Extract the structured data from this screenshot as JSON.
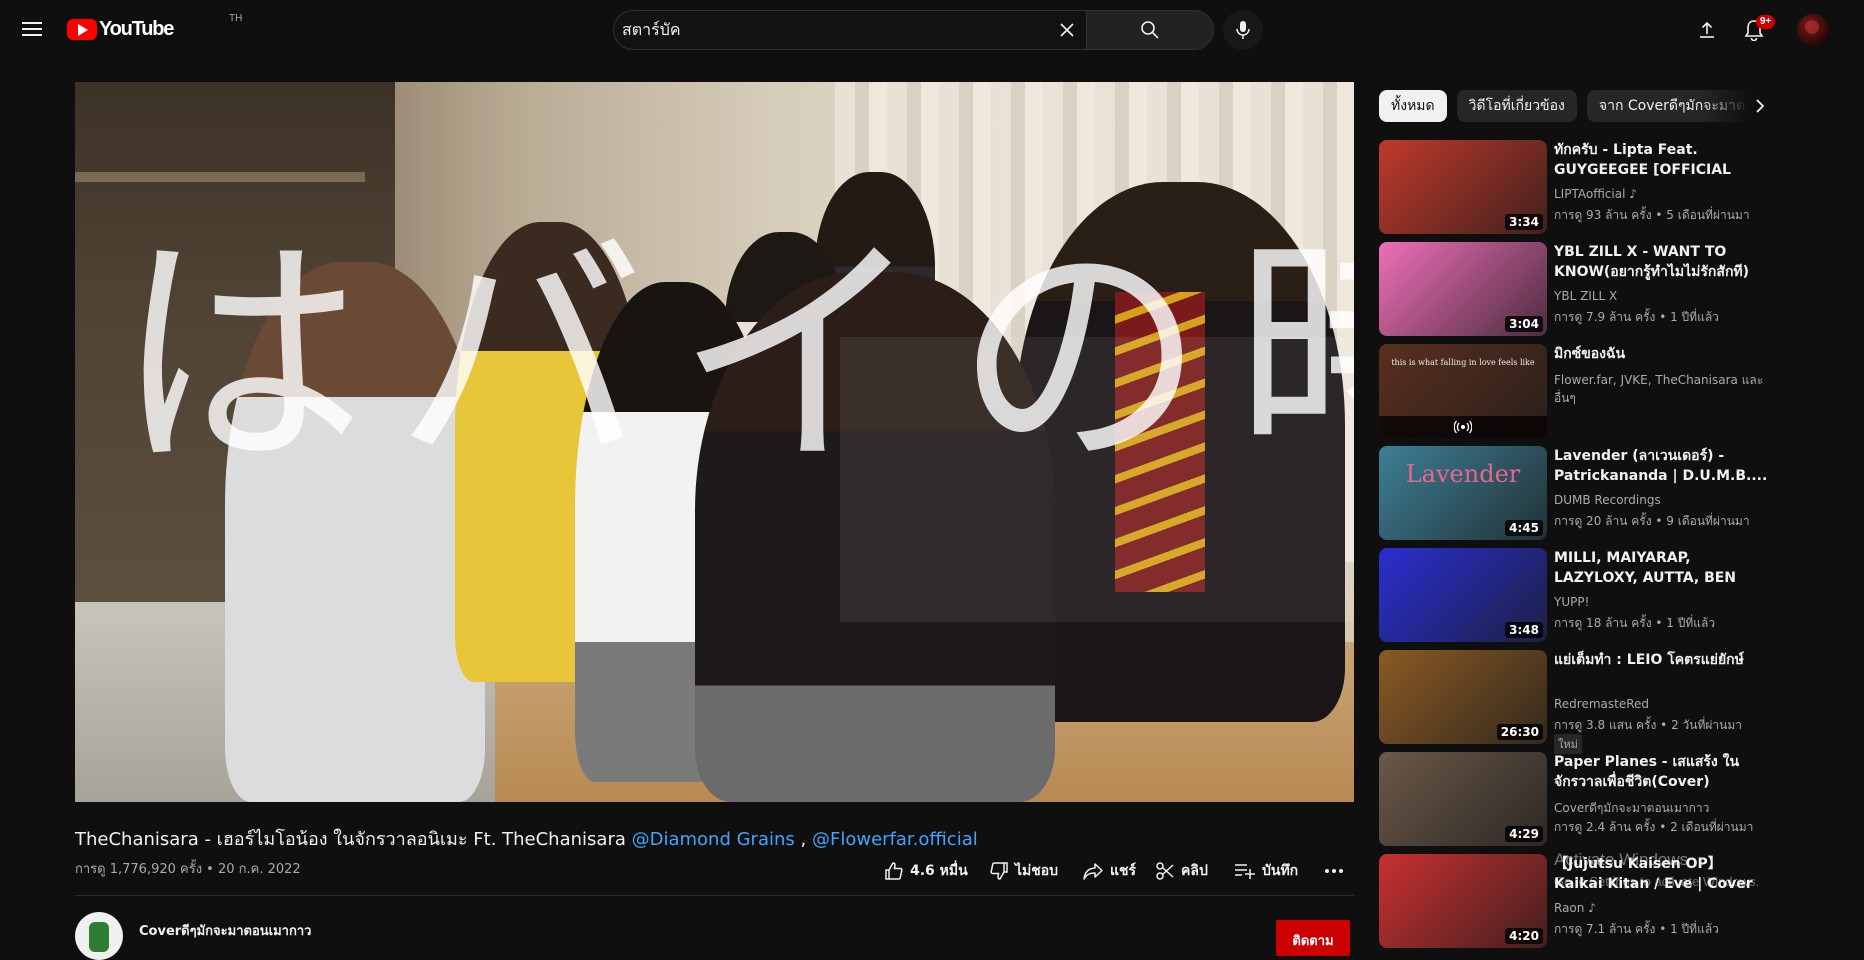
{
  "header": {
    "logo_text": "YouTube",
    "country_code": "TH",
    "search_value": "สตาร์บัค",
    "notification_count": "9+"
  },
  "player": {
    "overlay_text": "はバイの時"
  },
  "video": {
    "title_main": "TheChanisara - เฮอร์ไมโอน้อง ในจักรวาลอนิเมะ Ft. TheChanisara",
    "mention_1": "@Diamond Grains",
    "mention_sep": ",",
    "mention_2": "@Flowerfar.official",
    "meta": "การดู 1,776,920 ครั้ง • 20 ก.ค. 2022",
    "likes": "4.6 หมื่น",
    "dislike_label": "ไม่ชอบ",
    "share_label": "แชร์",
    "clip_label": "คลิป",
    "save_label": "บันทึก",
    "channel_name": "Coverดีๆมักจะมาตอนเมากาว",
    "subscribe_label": "ติดตาม"
  },
  "chips": [
    {
      "label": "ทั้งหมด",
      "active": true
    },
    {
      "label": "วิดีโอที่เกี่ยวข้อง",
      "active": false
    },
    {
      "label": "จาก Coverดีๆมักจะมาตอนเมากาว",
      "active": false
    }
  ],
  "recommendations": [
    {
      "title": "ทักครับ - Lipta Feat. GUYGEEGEE [OFFICIAL MUSIC VIDEO]",
      "channel": "LIPTAofficial ♪",
      "stats": "การดู 93 ล้าน ครั้ง • 5 เดือนที่ผ่านมา",
      "duration": "3:34",
      "thumb_color": "#c0392b"
    },
    {
      "title": "YBL ZILL X - WANT TO KNOW(อยากรู้ทำไมไม่รักสักที) ft...",
      "channel": "YBL ZILL X",
      "stats": "การดู 7.9 ล้าน ครั้ง • 1 ปีที่แล้ว",
      "duration": "3:04",
      "thumb_color": "#ef6fb8"
    },
    {
      "title": "มิกซ์ของฉัน",
      "channel": "Flower.far, JVKE, TheChanisara และอื่นๆ",
      "stats": "",
      "duration": "",
      "thumb_color": "#5a2f1e",
      "thumb_caption": "this is what falling in love feels like"
    },
    {
      "title": "Lavender (ลาเวนเดอร์) - Patrickananda | D.U.M.B....",
      "channel": "DUMB Recordings",
      "stats": "การดู 20 ล้าน ครั้ง • 9 เดือนที่ผ่านมา",
      "duration": "4:45",
      "thumb_color": "#3d7f95",
      "thumb_caption": "Lavender"
    },
    {
      "title": "MILLI, MAIYARAP, LAZYLOXY, AUTTA, BEN BIZZY, NAMEMT,...",
      "channel": "YUPP!",
      "stats": "การดู 18 ล้าน ครั้ง • 1 ปีที่แล้ว",
      "duration": "3:48",
      "thumb_color": "#2a2fd0"
    },
    {
      "title": "แย่เต็มทำ : LEIO โคตรแย่ยักษ์",
      "channel": "RedremasteRed",
      "stats": "การดู 3.8 แสน ครั้ง • 2 วันที่ผ่านมา",
      "duration": "26:30",
      "thumb_color": "#8a5a24",
      "badge": "ใหม่"
    },
    {
      "title": "Paper Planes - เสแสร้ง ในจักรวาลเพื่อชีวิต(Cover) Feat....",
      "channel": "Coverดีๆมักจะมาตอนเมากาว",
      "stats": "การดู 2.4 ล้าน ครั้ง • 2 เดือนที่ผ่านมา",
      "duration": "4:29",
      "thumb_color": "#6b5848"
    },
    {
      "title": "【Jujutsu Kaisen OP】Kaikai Kitan / Eve | Cover by Raon Lee",
      "channel": "Raon ♪",
      "stats": "การดู 7.1 ล้าน ครั้ง • 1 ปีที่แล้ว",
      "duration": "4:20",
      "thumb_color": "#c93030"
    }
  ],
  "windows_notice": {
    "line1": "Activate Windows",
    "line2": "Go to Settings to activate Windows."
  }
}
